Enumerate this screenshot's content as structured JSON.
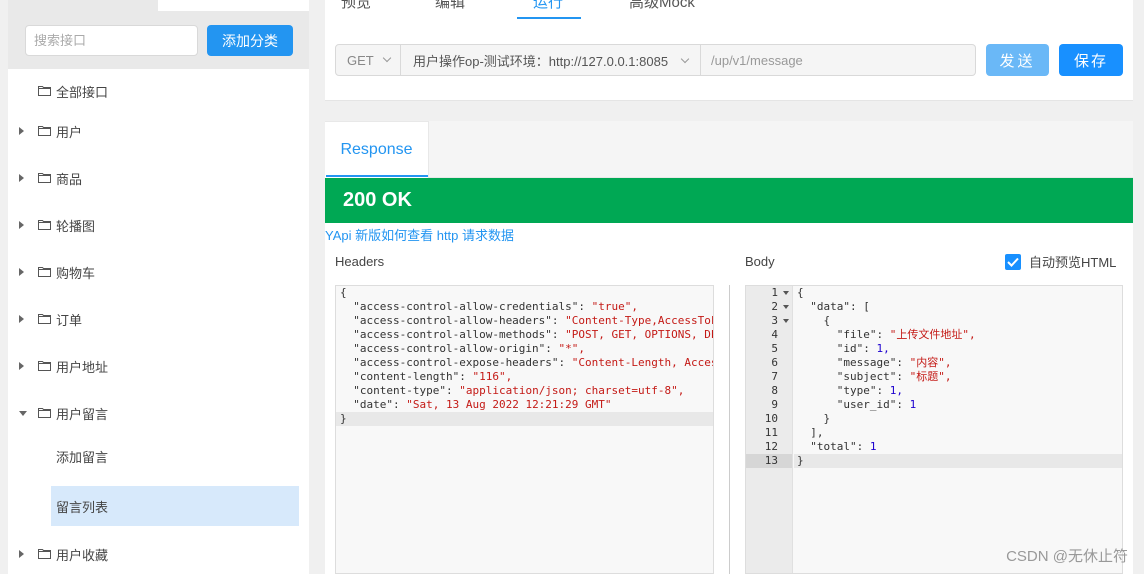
{
  "sidebar": {
    "search_placeholder": "搜索接口",
    "add_button": "添加分类",
    "tree": [
      {
        "label": "全部接口",
        "caret": "none"
      },
      {
        "label": "用户",
        "caret": "right"
      },
      {
        "label": "商品",
        "caret": "right"
      },
      {
        "label": "轮播图",
        "caret": "right"
      },
      {
        "label": "购物车",
        "caret": "right"
      },
      {
        "label": "订单",
        "caret": "right"
      },
      {
        "label": "用户地址",
        "caret": "right"
      },
      {
        "label": "用户留言",
        "caret": "down"
      },
      {
        "label": "用户收藏",
        "caret": "right"
      }
    ],
    "children": [
      {
        "label": "添加留言",
        "selected": false
      },
      {
        "label": "留言列表",
        "selected": true
      }
    ]
  },
  "top_tabs": [
    "预览",
    "编辑",
    "运行",
    "高级Mock"
  ],
  "active_tab": "运行",
  "request": {
    "method": "GET",
    "env": "用户操作op-测试环境：http://127.0.0.1:8085",
    "path": "/up/v1/message",
    "send_label": "发送",
    "save_label": "保存"
  },
  "response": {
    "tab_label": "Response",
    "status": "200 OK",
    "help_link": "YApi 新版如何查看 http 请求数据",
    "headers_label": "Headers",
    "body_label": "Body",
    "auto_preview_label": "自动预览HTML",
    "auto_preview_checked": true,
    "headers_lines": [
      {
        "k": "",
        "v": "{",
        "t": "p"
      },
      {
        "k": "  \"access-control-allow-credentials\": ",
        "v": "\"true\",",
        "t": "s"
      },
      {
        "k": "  \"access-control-allow-headers\": ",
        "v": "\"Content-Type,AccessTok",
        "t": "s"
      },
      {
        "k": "  \"access-control-allow-methods\": ",
        "v": "\"POST, GET, OPTIONS, DE",
        "t": "s"
      },
      {
        "k": "  \"access-control-allow-origin\": ",
        "v": "\"*\",",
        "t": "s"
      },
      {
        "k": "  \"access-control-expose-headers\": ",
        "v": "\"Content-Length, Acces",
        "t": "s"
      },
      {
        "k": "  \"content-length\": ",
        "v": "\"116\",",
        "t": "s"
      },
      {
        "k": "  \"content-type\": ",
        "v": "\"application/json; charset=utf-8\",",
        "t": "s"
      },
      {
        "k": "  \"date\": ",
        "v": "\"Sat, 13 Aug 2022 12:21:29 GMT\"",
        "t": "s"
      },
      {
        "k": "",
        "v": "}",
        "t": "p"
      }
    ],
    "body_lines": [
      {
        "n": "1",
        "fold": true,
        "k": "",
        "v": "{",
        "t": "p"
      },
      {
        "n": "2",
        "fold": true,
        "k": "  \"data\": ",
        "v": "[",
        "t": "p"
      },
      {
        "n": "3",
        "fold": true,
        "k": "    ",
        "v": "{",
        "t": "p"
      },
      {
        "n": "4",
        "fold": false,
        "k": "      \"file\": ",
        "v": "\"上传文件地址\",",
        "t": "s"
      },
      {
        "n": "5",
        "fold": false,
        "k": "      \"id\": ",
        "v": "1,",
        "t": "n"
      },
      {
        "n": "6",
        "fold": false,
        "k": "      \"message\": ",
        "v": "\"内容\",",
        "t": "s"
      },
      {
        "n": "7",
        "fold": false,
        "k": "      \"subject\": ",
        "v": "\"标题\",",
        "t": "s"
      },
      {
        "n": "8",
        "fold": false,
        "k": "      \"type\": ",
        "v": "1,",
        "t": "n"
      },
      {
        "n": "9",
        "fold": false,
        "k": "      \"user_id\": ",
        "v": "1",
        "t": "n"
      },
      {
        "n": "10",
        "fold": false,
        "k": "    ",
        "v": "}",
        "t": "p"
      },
      {
        "n": "11",
        "fold": false,
        "k": "  ",
        "v": "],",
        "t": "p"
      },
      {
        "n": "12",
        "fold": false,
        "k": "  \"total\": ",
        "v": "1",
        "t": "n"
      },
      {
        "n": "13",
        "fold": false,
        "k": "",
        "v": "}",
        "t": "p"
      }
    ]
  },
  "watermark": "CSDN @无休止符",
  "colors": {
    "accent": "#2395f1",
    "success": "#00a854",
    "string": "#c41a16",
    "number": "#1c00cf"
  }
}
